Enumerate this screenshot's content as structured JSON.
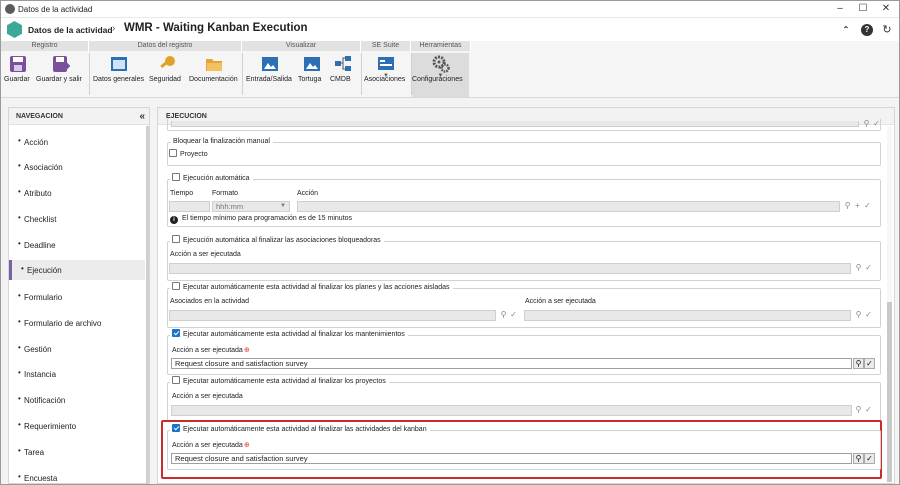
{
  "window": {
    "title": "Datos de la actividad"
  },
  "header": {
    "breadcrumb_root": "Datos de la actividad",
    "title": "WMR - Waiting Kanban Execution"
  },
  "ribbon": {
    "groups": [
      "Registro",
      "Datos del registro",
      "Visualizar",
      "SE Suite",
      "Herramientas"
    ],
    "buttons": {
      "guardar": "Guardar",
      "guardar_salir": "Guardar y salir",
      "datos_generales": "Datos generales",
      "seguridad": "Seguridad",
      "documentacion": "Documentación",
      "entrada_salida": "Entrada/Salida",
      "tortuga": "Tortuga",
      "cmdb": "CMDB",
      "asociaciones": "Asociaciones",
      "configuraciones": "Configuraciones"
    }
  },
  "nav": {
    "title": "NAVEGACION",
    "selected": "Ejecución",
    "items": [
      "Acción",
      "Asociación",
      "Atributo",
      "Checklist",
      "Deadline",
      "Ejecución",
      "Formulario",
      "Formulario de archivo",
      "Gestión",
      "Instancia",
      "Notificación",
      "Requerimiento",
      "Tarea",
      "Encuesta"
    ]
  },
  "main": {
    "title": "EJECUCION",
    "bloquear": {
      "legend": "Bloquear la finalización manual",
      "proyecto": "Proyecto",
      "proyecto_checked": false
    },
    "auto": {
      "legend": "Ejecución automática",
      "checked": false,
      "tiempo": "Tiempo",
      "formato": "Formato",
      "accion": "Acción",
      "formato_value": "hhh:mm",
      "info": "El tiempo mínimo para programación es de 15 minutos"
    },
    "assoc_bloq": {
      "legend": "Ejecución automática al finalizar las asociaciones bloqueadoras",
      "checked": false,
      "accion": "Acción a ser ejecutada"
    },
    "planes": {
      "legend": "Ejecutar automáticamente esta actividad al finalizar los planes y las acciones aisladas",
      "checked": false,
      "asociados": "Asociados en la actividad",
      "accion": "Acción a ser ejecutada"
    },
    "mant": {
      "legend": "Ejecutar automáticamente esta actividad al finalizar los mantenimientos",
      "checked": true,
      "accion": "Acción a ser ejecutada",
      "value": "Request closure and satisfaction survey"
    },
    "proy": {
      "legend": "Ejecutar automáticamente esta actividad al finalizar los proyectos",
      "checked": false,
      "accion": "Acción a ser ejecutada"
    },
    "kanban": {
      "legend": "Ejecutar automáticamente esta actividad al finalizar las actividades del kanban",
      "checked": true,
      "accion": "Acción a ser ejecutada",
      "value": "Request closure and satisfaction survey"
    }
  },
  "colors": {
    "accent": "#1a73c8",
    "highlight": "#cc2b2b",
    "nav_selected_bar": "#7a5ea6"
  }
}
